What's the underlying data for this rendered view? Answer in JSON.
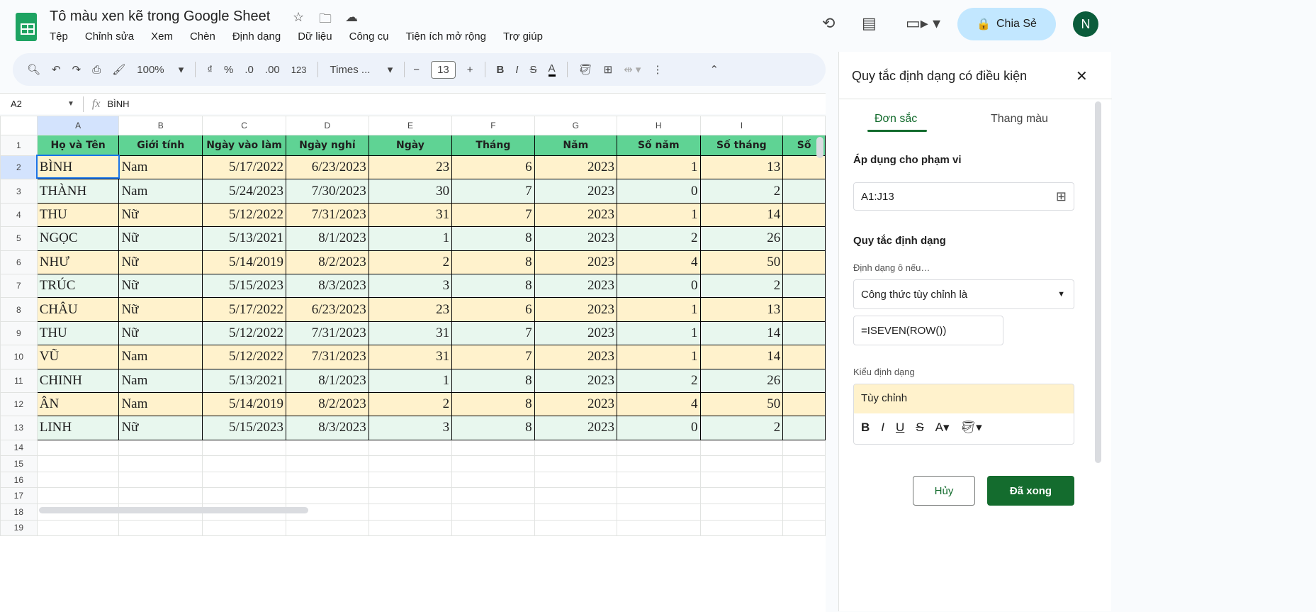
{
  "title": "Tô màu xen kẽ trong Google Sheet",
  "menu": [
    "Tệp",
    "Chỉnh sửa",
    "Xem",
    "Chèn",
    "Định dạng",
    "Dữ liệu",
    "Công cụ",
    "Tiện ích mở rộng",
    "Trợ giúp"
  ],
  "share_label": "Chia Sẻ",
  "avatar": "N",
  "toolbar": {
    "zoom": "100%",
    "currency": "₫",
    "percent": "%",
    "dec_less": ".0",
    "dec_more": ".00",
    "number_format": "123",
    "font": "Times ...",
    "font_size": "13"
  },
  "formula_bar": {
    "cell_ref": "A2",
    "fx": "fx",
    "value": "BÌNH"
  },
  "columns": [
    "A",
    "B",
    "C",
    "D",
    "E",
    "F",
    "G",
    "H",
    "I"
  ],
  "header_row": [
    "Họ và Tên",
    "Giới tính",
    "Ngày vào làm",
    "Ngày nghỉ",
    "Ngày",
    "Tháng",
    "Năm",
    "Số năm",
    "Số tháng",
    "Số"
  ],
  "rows": [
    [
      "BÌNH",
      "Nam",
      "5/17/2022",
      "6/23/2023",
      "23",
      "6",
      "2023",
      "1",
      "13"
    ],
    [
      "THÀNH",
      "Nam",
      "5/24/2023",
      "7/30/2023",
      "30",
      "7",
      "2023",
      "0",
      "2"
    ],
    [
      "THU",
      "Nữ",
      "5/12/2022",
      "7/31/2023",
      "31",
      "7",
      "2023",
      "1",
      "14"
    ],
    [
      "NGỌC",
      "Nữ",
      "5/13/2021",
      "8/1/2023",
      "1",
      "8",
      "2023",
      "2",
      "26"
    ],
    [
      "NHƯ",
      "Nữ",
      "5/14/2019",
      "8/2/2023",
      "2",
      "8",
      "2023",
      "4",
      "50"
    ],
    [
      "TRÚC",
      "Nữ",
      "5/15/2023",
      "8/3/2023",
      "3",
      "8",
      "2023",
      "0",
      "2"
    ],
    [
      "CHÂU",
      "Nữ",
      "5/17/2022",
      "6/23/2023",
      "23",
      "6",
      "2023",
      "1",
      "13"
    ],
    [
      "THU",
      "Nữ",
      "5/12/2022",
      "7/31/2023",
      "31",
      "7",
      "2023",
      "1",
      "14"
    ],
    [
      "VŨ",
      "Nam",
      "5/12/2022",
      "7/31/2023",
      "31",
      "7",
      "2023",
      "1",
      "14"
    ],
    [
      "CHINH",
      "Nam",
      "5/13/2021",
      "8/1/2023",
      "1",
      "8",
      "2023",
      "2",
      "26"
    ],
    [
      "ÂN",
      "Nam",
      "5/14/2019",
      "8/2/2023",
      "2",
      "8",
      "2023",
      "4",
      "50"
    ],
    [
      "LINH",
      "Nữ",
      "5/15/2023",
      "8/3/2023",
      "3",
      "8",
      "2023",
      "0",
      "2"
    ]
  ],
  "panel": {
    "title": "Quy tắc định dạng có điều kiện",
    "tab_single": "Đơn sắc",
    "tab_scale": "Thang màu",
    "range_label": "Áp dụng cho phạm vi",
    "range": "A1:J13",
    "rules_label": "Quy tắc định dạng",
    "condition_label": "Định dạng ô nếu…",
    "condition": "Công thức tùy chỉnh là",
    "formula": "=ISEVEN(ROW())",
    "style_label": "Kiểu định dạng",
    "style_value": "Tùy chỉnh",
    "cancel": "Hủy",
    "done": "Đã xong"
  }
}
